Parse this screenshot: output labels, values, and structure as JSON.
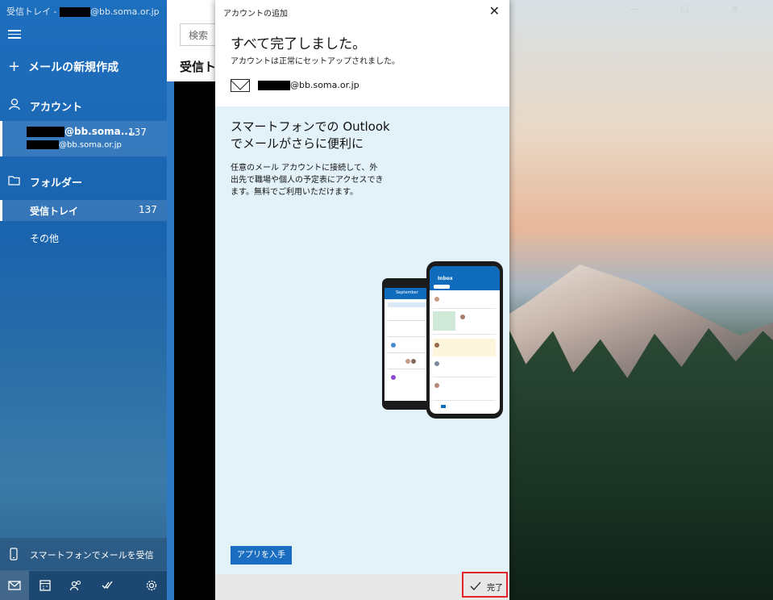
{
  "window": {
    "title_prefix": "受信トレイ - ",
    "title_domain": "@bb.soma.or.jp",
    "controls": "— ☐ ✕"
  },
  "left_pane": {
    "new_mail": "メールの新規作成",
    "accounts_label": "アカウント",
    "account": {
      "name_suffix": "@bb.soma....",
      "count": "137",
      "email_suffix": "@bb.soma.or.jp"
    },
    "folders_label": "フォルダー",
    "folders": [
      {
        "label": "受信トレイ",
        "count": "137"
      },
      {
        "label": "その他",
        "count": ""
      }
    ],
    "phone_promo": "スマートフォンでメールを受信"
  },
  "middle_pane": {
    "search_placeholder": "検索",
    "header": "受信トレイ"
  },
  "dialog": {
    "title": "アカウントの追加",
    "heading": "すべて完了しました。",
    "subheading": "アカウントは正常にセットアップされました。",
    "email_suffix": "@bb.soma.or.jp",
    "promo_title": "スマートフォンでの Outlook でメールがさらに便利に",
    "promo_body": "任意のメール アカウントに接続して、外出先で職場や個人の予定表にアクセスできます。無料でご利用いただけます。",
    "get_app_button": "アプリを入手",
    "done_button": "完了"
  },
  "phone_illustration": {
    "front_screen_title": "Inbox",
    "back_screen_title": "September"
  },
  "colors": {
    "accent": "#1a6dc0",
    "highlight_border": "#e0242a",
    "promo_background": "#e3f2f9"
  }
}
